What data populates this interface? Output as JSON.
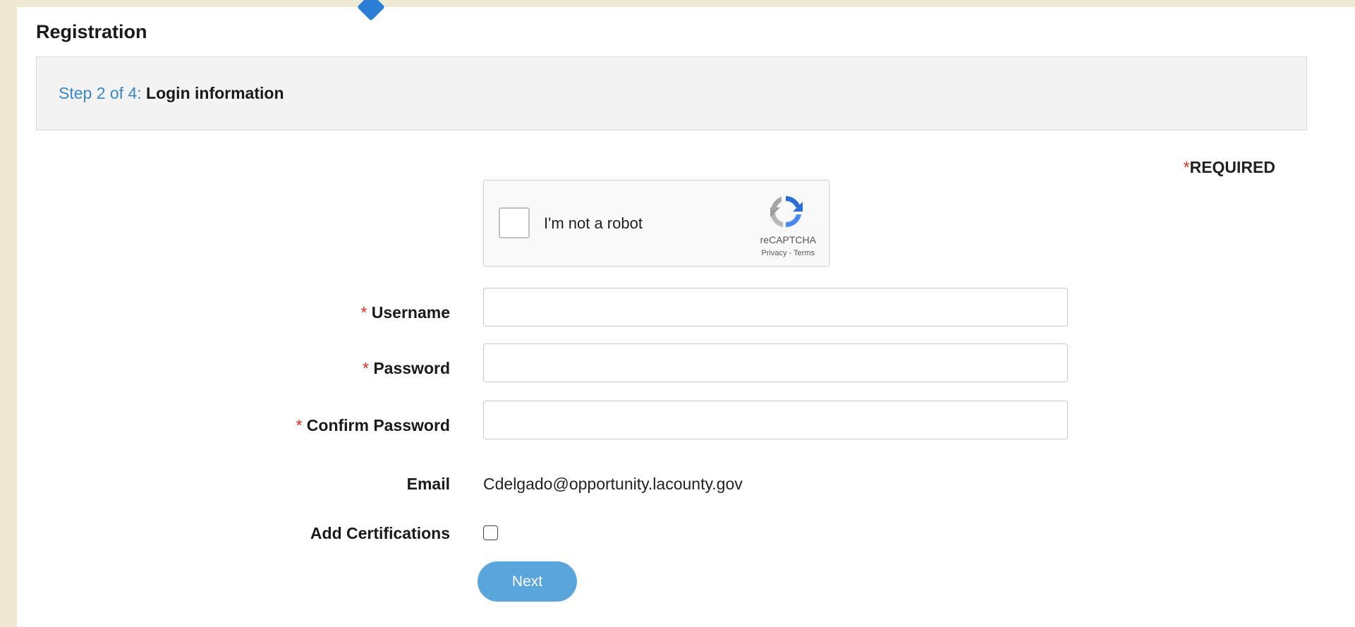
{
  "page": {
    "title": "Registration"
  },
  "step": {
    "number_text": "Step 2 of 4:",
    "name": "Login information"
  },
  "required_note": {
    "asterisk": "*",
    "text": "REQUIRED"
  },
  "captcha": {
    "label": "I'm not a robot",
    "brand": "reCAPTCHA",
    "links": "Privacy - Terms"
  },
  "form": {
    "username": {
      "asterisk": "*",
      "label": "Username",
      "value": ""
    },
    "password": {
      "asterisk": "*",
      "label": "Password",
      "value": ""
    },
    "confirm_password": {
      "asterisk": "*",
      "label": "Confirm Password",
      "value": ""
    },
    "email": {
      "label": "Email",
      "value": "Cdelgado@opportunity.lacounty.gov"
    },
    "certifications": {
      "label": "Add Certifications",
      "checked": false
    }
  },
  "actions": {
    "next_label": "Next"
  },
  "colors": {
    "accent": "#3a86c8",
    "button": "#5aa5dc",
    "required": "#e03020",
    "background": "#efe8d2"
  }
}
